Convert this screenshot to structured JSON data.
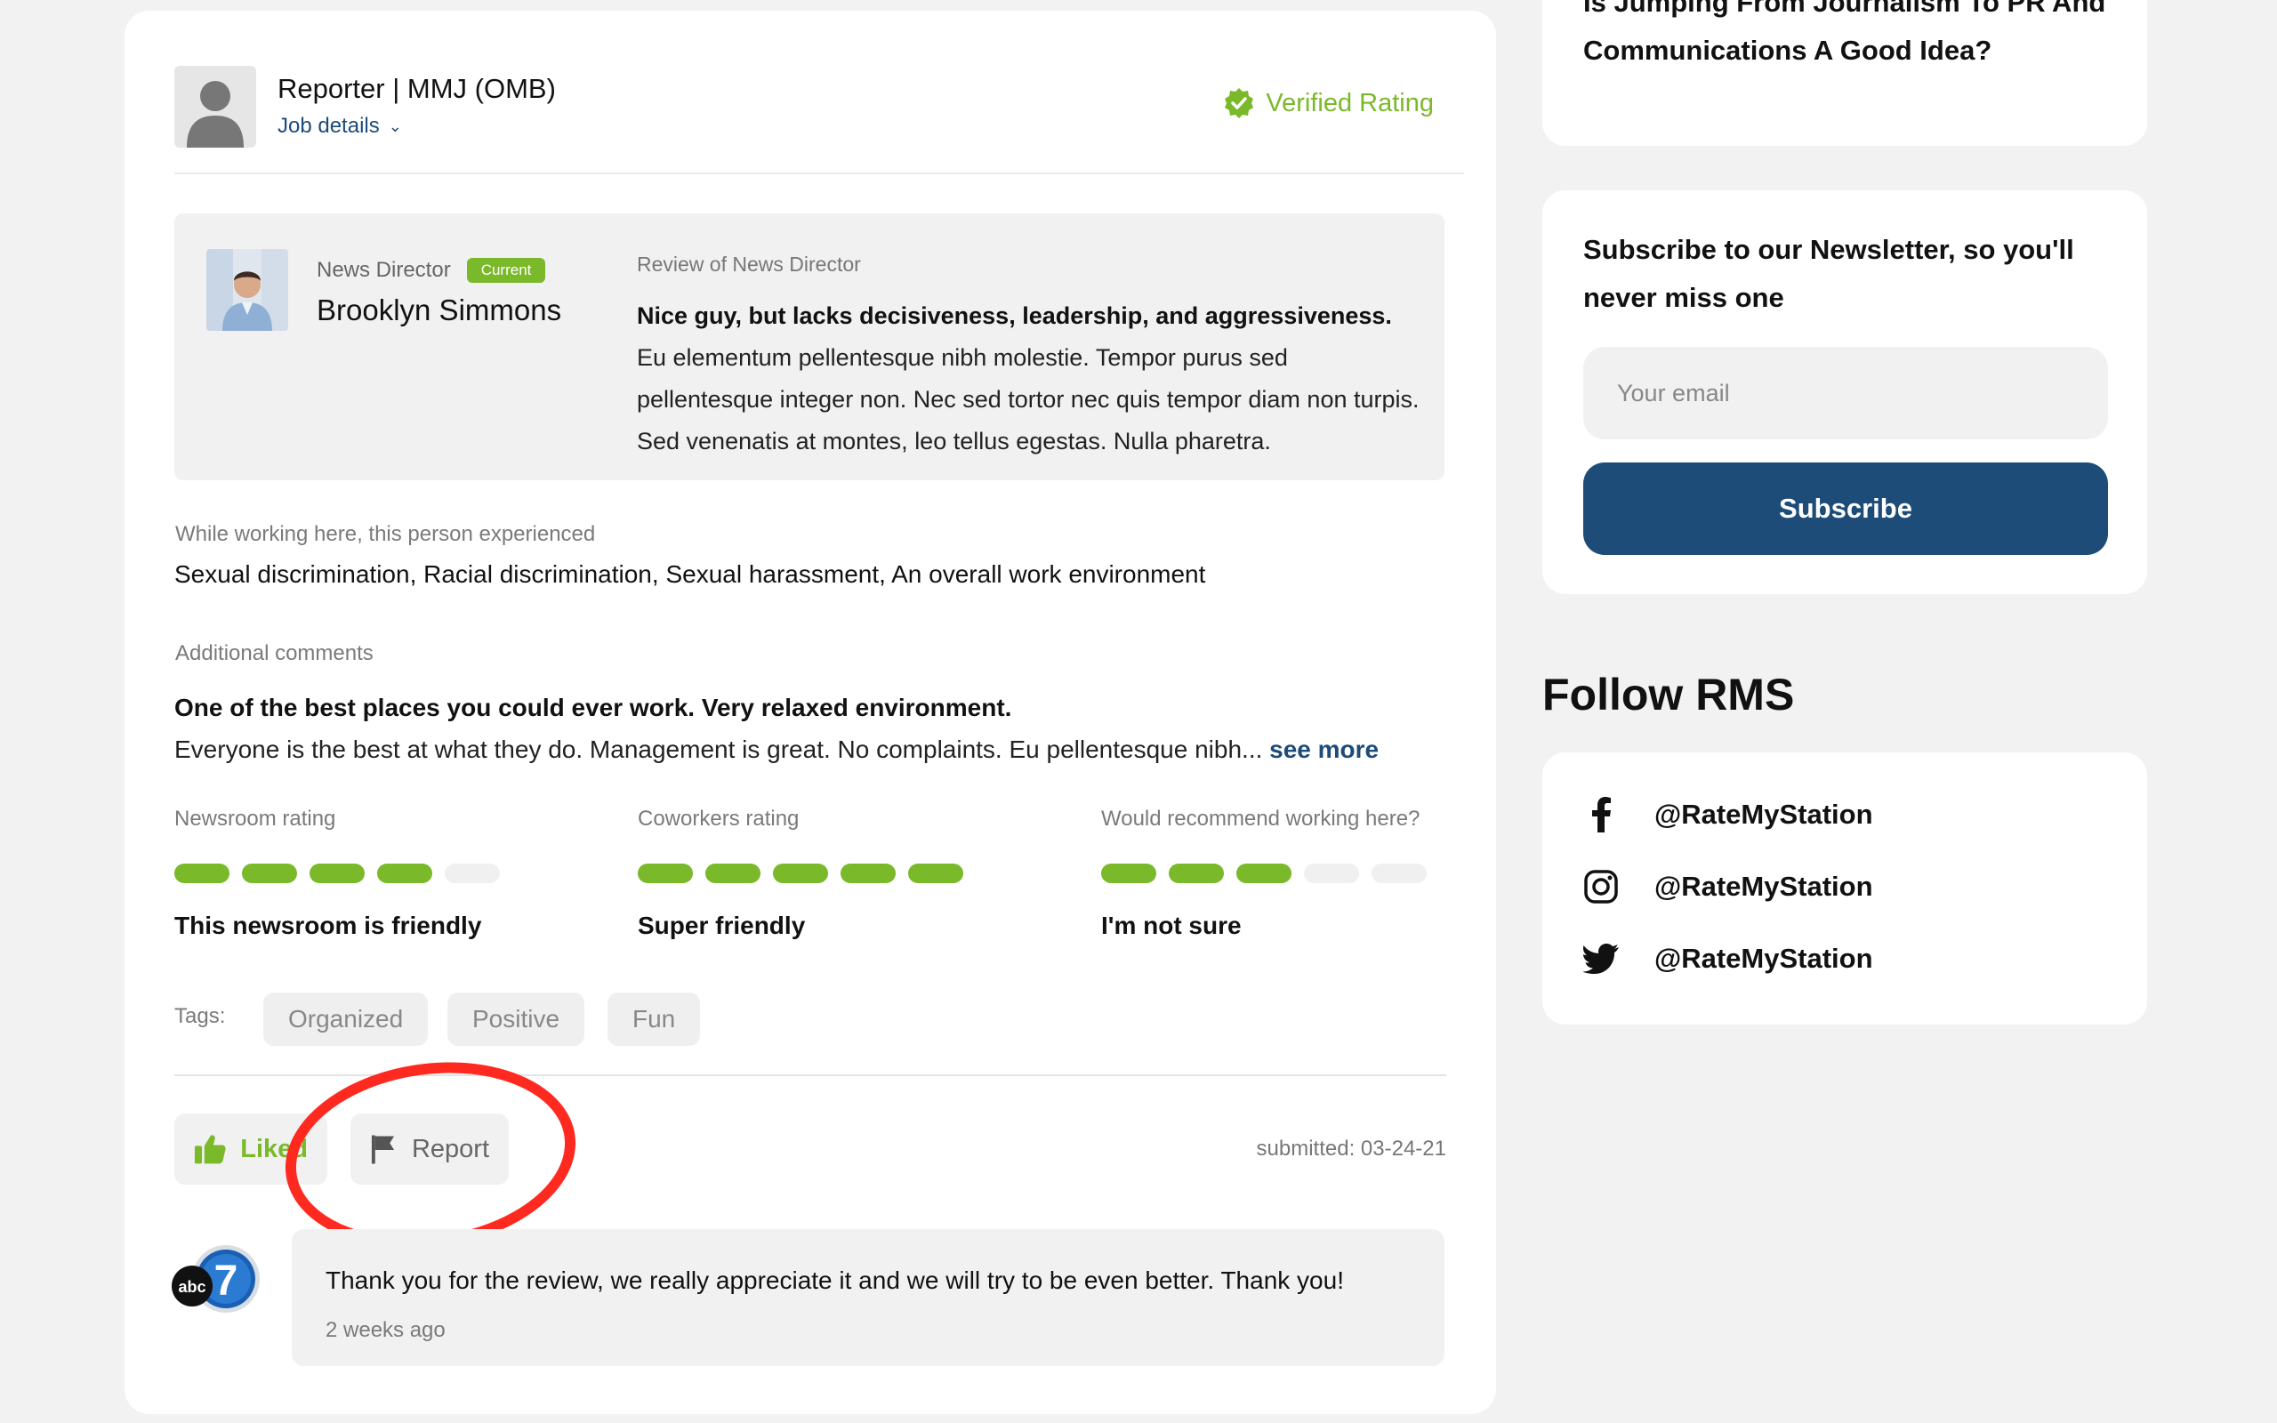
{
  "review": {
    "job_title": "Reporter | MMJ (OMB)",
    "job_details_label": "Job details",
    "verified_label": "Verified Rating",
    "person": {
      "role": "News Director",
      "status": "Current",
      "name": "Brooklyn Simmons"
    },
    "review_of": "Review of News Director",
    "review_headline": "Nice guy, but lacks decisiveness, leadership, and aggressiveness.",
    "review_body": "Eu elementum pellentesque nibh molestie. Tempor purus sed pellentesque integer non. Nec sed tortor nec quis tempor diam non turpis. Sed venenatis at montes, leo tellus egestas. Nulla pharetra.",
    "experienced_label": "While working here, this person experienced",
    "experienced_value": "Sexual discrimination, Racial discrimination, Sexual harassment, An overall work environment",
    "comments_label": "Additional comments",
    "comments_headline": "One of the best places you could ever work. Very relaxed environment.",
    "comments_body": "Everyone is the best at what they do. Management is great. No complaints. Eu pellentesque nibh...",
    "see_more_label": "see more",
    "ratings": [
      {
        "label": "Newsroom rating",
        "score": 4,
        "max": 5,
        "text": "This newsroom is friendly"
      },
      {
        "label": "Coworkers rating",
        "score": 5,
        "max": 5,
        "text": "Super friendly"
      },
      {
        "label": "Would recommend working here?",
        "score": 3,
        "max": 5,
        "text": "I'm not sure"
      }
    ],
    "tags_label": "Tags:",
    "tags": [
      "Organized",
      "Positive",
      "Fun"
    ],
    "like_label": "Liked",
    "report_label": "Report",
    "submitted": "submitted: 03-24-21",
    "reply": {
      "text": "Thank you for the review, we really appreciate it and we will try to be even better. Thank you!",
      "time": "2 weeks ago",
      "logo_text": "abc",
      "logo_number": "7"
    }
  },
  "sidebar": {
    "article_title": "Is Jumping From Journalism To PR And Communications A Good Idea?",
    "newsletter_title": "Subscribe to our Newsletter, so you'll never miss one",
    "email_placeholder": "Your email",
    "subscribe_label": "Subscribe",
    "follow_title": "Follow RMS",
    "socials": [
      {
        "icon": "facebook-icon",
        "handle": "@RateMyStation"
      },
      {
        "icon": "instagram-icon",
        "handle": "@RateMyStation"
      },
      {
        "icon": "twitter-icon",
        "handle": "@RateMyStation"
      }
    ]
  },
  "colors": {
    "accent_green": "#7ab929",
    "brand_blue": "#1c4c77",
    "annotation_red": "#ff2a1f"
  }
}
